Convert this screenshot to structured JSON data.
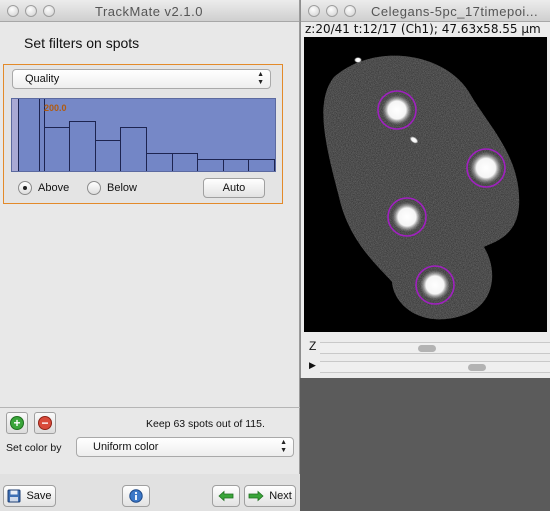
{
  "trackmate": {
    "title": "TrackMate v2.1.0",
    "heading": "Set filters on spots",
    "filter": {
      "feature": "Quality",
      "threshold": "200.0",
      "above_label": "Above",
      "below_label": "Below",
      "selected_mode": "Above",
      "auto_label": "Auto"
    },
    "histogram_bins": [
      100,
      60,
      68,
      42,
      60,
      24,
      24,
      16,
      16,
      16
    ],
    "keep_text": "Keep 63 spots out of  115.",
    "set_color_label": "Set color by",
    "color_mode": "Uniform color",
    "save_label": "Save",
    "next_label": "Next"
  },
  "image_window": {
    "title": "Celegans-5pc_17timepoi...",
    "info": "z:20/41 t:12/17 (Ch1); 47.63x58.55 µm",
    "z_label": "Z",
    "play_label": "▶"
  },
  "colors": {
    "panel_border": "#e38a2a",
    "histogram_fill": "#7688c7",
    "spot_circle": "#a020c0",
    "threshold_text": "#b05a10"
  }
}
